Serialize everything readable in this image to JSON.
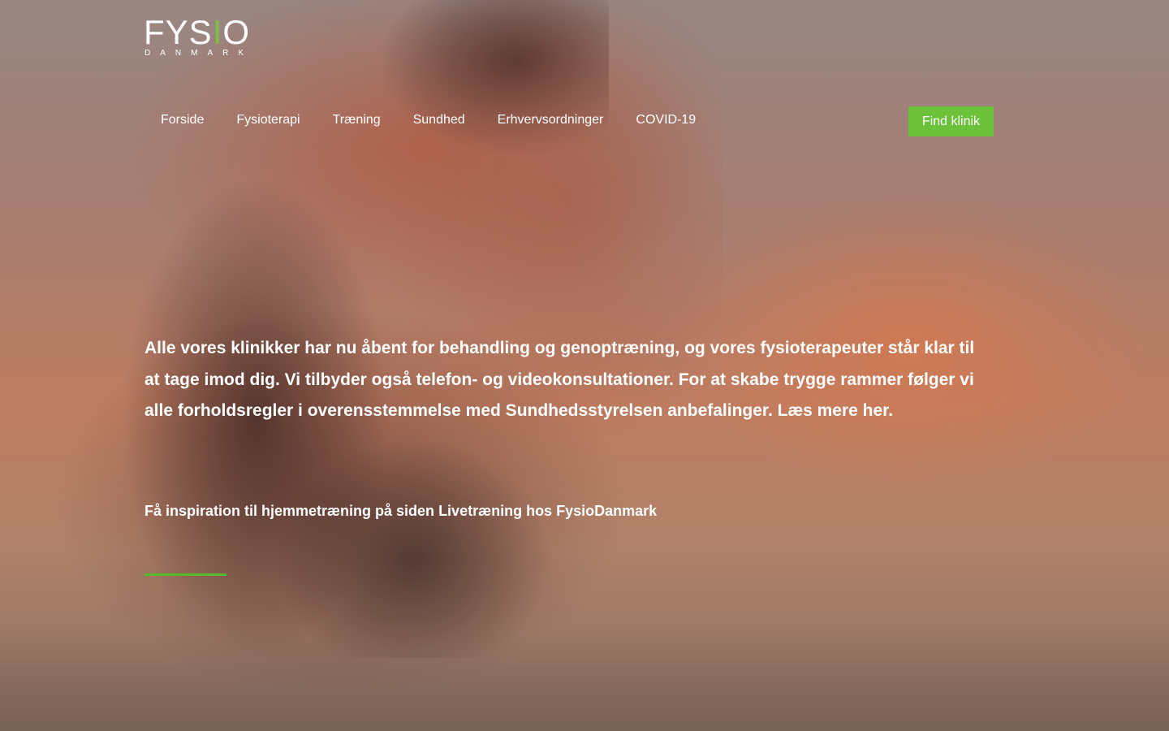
{
  "brand": {
    "logo_main_a": "FYS",
    "logo_main_accent": "I",
    "logo_main_b": "O",
    "logo_sub": "DANMARK",
    "accent_color": "#7ac143"
  },
  "nav": {
    "items": [
      {
        "label": "Forside"
      },
      {
        "label": "Fysioterapi"
      },
      {
        "label": "Træning"
      },
      {
        "label": "Sundhed"
      },
      {
        "label": "Erhvervsordninger"
      },
      {
        "label": "COVID-19"
      }
    ],
    "cta_label": "Find klinik",
    "cta_color": "#6cc13a"
  },
  "hero": {
    "paragraph_main": "Alle vores klinikker har nu åbent for behandling og genoptræning, og vores fysioterapeuter står klar til at tage imod dig. Vi tilbyder også telefon- og videokonsultationer. For at skabe trygge rammer følger vi alle forholdsregler i overensstemmelse med Sundhedsstyrelsen anbefalinger. ",
    "read_more_link": "Læs mere her.",
    "inspiration_prefix": "Få inspiration til hjemmetræning på siden ",
    "inspiration_link": "Livetræning hos FysioDanmark",
    "divider_color": "#5ab82e"
  }
}
